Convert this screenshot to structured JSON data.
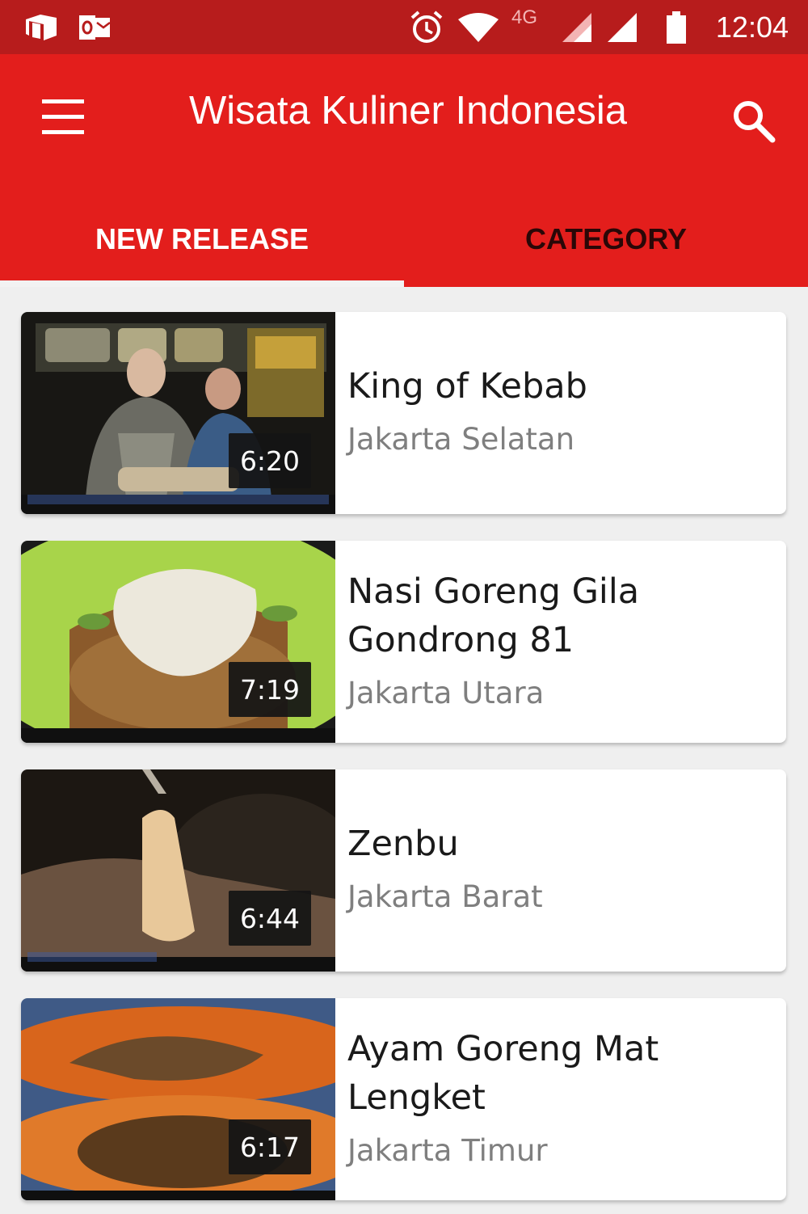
{
  "status_bar": {
    "network": "4G",
    "time": "12:04"
  },
  "app_bar": {
    "title": "Wisata Kuliner Indonesia"
  },
  "tabs": [
    {
      "label": "NEW RELEASE",
      "active": true
    },
    {
      "label": "CATEGORY",
      "active": false
    }
  ],
  "videos": [
    {
      "title": "King of Kebab",
      "location": "Jakarta Selatan",
      "duration": "6:20"
    },
    {
      "title": "Nasi Goreng Gila Gondrong 81",
      "location": "Jakarta Utara",
      "duration": "7:19"
    },
    {
      "title": "Zenbu",
      "location": "Jakarta Barat",
      "duration": "6:44"
    },
    {
      "title": "Ayam Goreng Mat Lengket",
      "location": "Jakarta Timur",
      "duration": "6:17"
    }
  ],
  "colors": {
    "status_bar": "#b71c1c",
    "primary": "#e31e1c",
    "tab_inactive": "#2a0707",
    "background": "#efefef"
  },
  "icons": [
    "notification-app-icon",
    "outlook-icon",
    "alarm-icon",
    "wifi-icon",
    "cell-signal-icon",
    "battery-icon",
    "menu-icon",
    "search-icon"
  ]
}
